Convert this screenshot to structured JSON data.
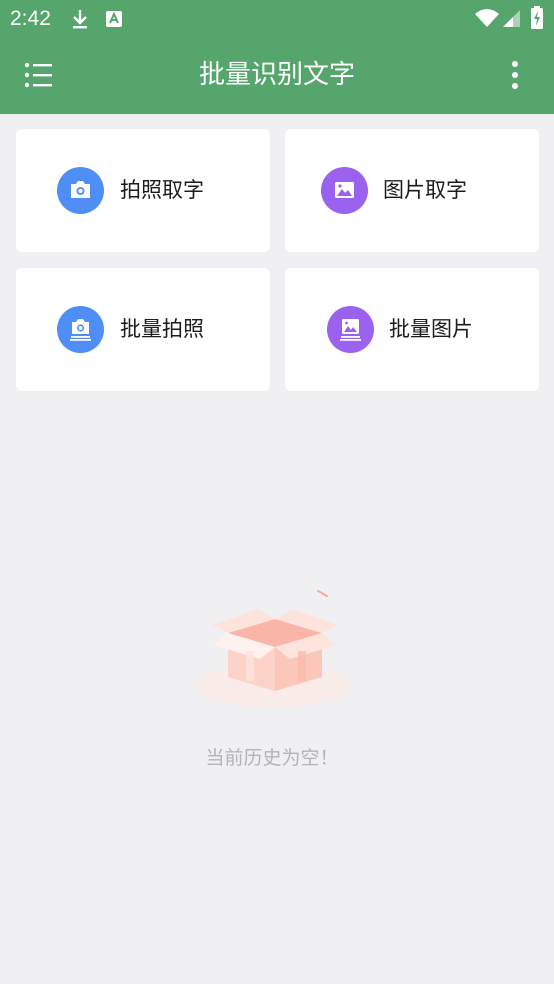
{
  "status_bar": {
    "time": "2:42",
    "icons": [
      "download-icon",
      "text-a-icon",
      "wifi-icon",
      "signal-icon",
      "battery-charging-icon"
    ]
  },
  "toolbar": {
    "title": "批量识别文字",
    "menu_icon": "list-menu-icon",
    "more_icon": "more-vert-icon",
    "color": "#56a56c"
  },
  "actions": [
    {
      "label": "拍照取字",
      "icon": "camera-icon",
      "color": "#4f8ef5"
    },
    {
      "label": "图片取字",
      "icon": "image-icon",
      "color": "#9a62ee"
    },
    {
      "label": "批量拍照",
      "icon": "batch-camera-icon",
      "color": "#4f8ef5"
    },
    {
      "label": "批量图片",
      "icon": "batch-image-icon",
      "color": "#9a62ee"
    }
  ],
  "history": {
    "empty_text": "当前历史为空！",
    "empty_icon": "empty-box-icon"
  }
}
